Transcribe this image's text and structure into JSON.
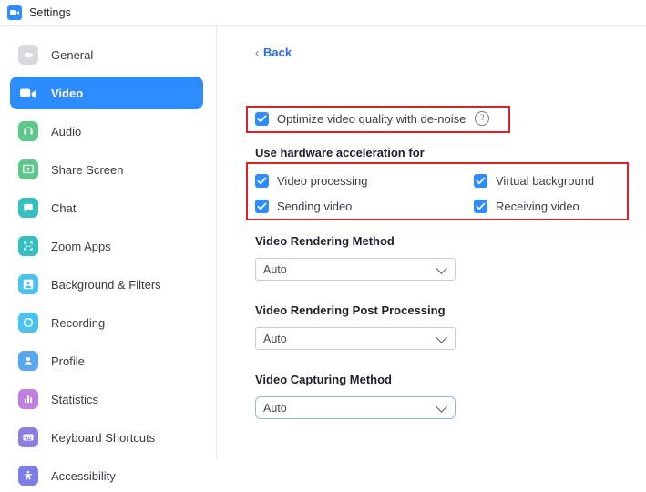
{
  "window": {
    "title": "Settings",
    "app_icon": "zoom-video-icon"
  },
  "sidebar": {
    "items": [
      {
        "label": "General",
        "icon": "gear-icon",
        "color": "#d7d9de",
        "active": false
      },
      {
        "label": "Video",
        "icon": "video-camera-icon",
        "color": "#2d8cff",
        "active": true
      },
      {
        "label": "Audio",
        "icon": "headphones-icon",
        "color": "#5cc98a",
        "active": false
      },
      {
        "label": "Share Screen",
        "icon": "share-screen-icon",
        "color": "#5cc98a",
        "active": false
      },
      {
        "label": "Chat",
        "icon": "chat-bubble-icon",
        "color": "#35bfc0",
        "active": false
      },
      {
        "label": "Zoom Apps",
        "icon": "zoom-apps-icon",
        "color": "#35bfc0",
        "active": false
      },
      {
        "label": "Background & Filters",
        "icon": "person-frame-icon",
        "color": "#4bc3ef",
        "active": false
      },
      {
        "label": "Recording",
        "icon": "record-circle-icon",
        "color": "#4bc3ef",
        "active": false
      },
      {
        "label": "Profile",
        "icon": "person-icon",
        "color": "#5aa7f0",
        "active": false
      },
      {
        "label": "Statistics",
        "icon": "bar-chart-icon",
        "color": "#c07fe0",
        "active": false
      },
      {
        "label": "Keyboard Shortcuts",
        "icon": "keyboard-icon",
        "color": "#8a7fe0",
        "active": false
      },
      {
        "label": "Accessibility",
        "icon": "accessibility-icon",
        "color": "#7a7fe8",
        "active": false
      }
    ]
  },
  "main": {
    "back": {
      "label": "Back",
      "chevron": "‹"
    },
    "denoise": {
      "label": "Optimize video quality with de-noise",
      "checked": true,
      "help_icon": "question-mark-icon",
      "help_glyph": "?"
    },
    "hardware_acceleration": {
      "heading": "Use hardware acceleration for",
      "options": [
        {
          "label": "Video processing",
          "checked": true
        },
        {
          "label": "Virtual background",
          "checked": true
        },
        {
          "label": "Sending video",
          "checked": true
        },
        {
          "label": "Receiving video",
          "checked": true
        }
      ]
    },
    "dropdowns": [
      {
        "title": "Video Rendering Method",
        "value": "Auto",
        "focused": false
      },
      {
        "title": "Video Rendering Post Processing",
        "value": "Auto",
        "focused": false
      },
      {
        "title": "Video Capturing Method",
        "value": "Auto",
        "focused": true
      }
    ]
  },
  "annotations": {
    "highlight_color": "#e01f26",
    "boxes": [
      "denoise-highlight",
      "hardware-acceleration-highlight"
    ]
  },
  "colors": {
    "accent": "#2d8cff",
    "link": "#2d6cdf",
    "checkbox": "#2d8cff",
    "highlight": "#e01f26"
  }
}
